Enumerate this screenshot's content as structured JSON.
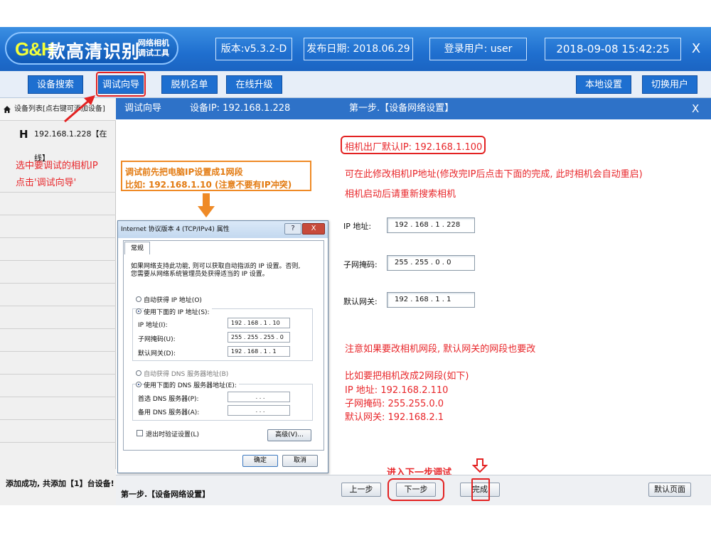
{
  "header": {
    "logo_gh": "G&H",
    "logo_main": "款高清识别",
    "logo_sub_line1": "网络相机",
    "logo_sub_line2": "调试工具",
    "version": "版本:v5.3.2-D",
    "release_date": "发布日期: 2018.06.29",
    "login_user": "登录用户: user",
    "datetime": "2018-09-08 15:42:25",
    "close_label": "X"
  },
  "toolbar": {
    "device_search": "设备搜索",
    "debug_wizard": "调试向导",
    "offline_list": "脱机名单",
    "online_upgrade": "在线升级",
    "local_settings": "本地设置",
    "switch_user": "切换用户"
  },
  "left_panel": {
    "heading": "设备列表[点右键可添加设备]",
    "device_prefix": "H",
    "device_label": "192.168.1.228【在线】",
    "annotation_line1": "选中要调试的相机IP",
    "annotation_line2": "点击'调试向导'",
    "status": "添加成功, 共添加【1】台设备!"
  },
  "panel_header": {
    "title": "调试向导",
    "device_ip": "设备IP: 192.168.1.228",
    "step": "第一步.【设备网络设置】",
    "close": "X"
  },
  "notes": {
    "default_ip": "相机出厂默认IP: 192.168.1.100",
    "modify_line1": "可在此修改相机IP地址(修改完IP后点击下面的完成, 此时相机会自动重启)",
    "modify_line2": "相机启动后请重新搜索相机",
    "segment_note": "注意如果要改相机网段, 默认网关的网段也要改",
    "example_title": "比如要把相机改成2网段(如下)",
    "example_ip": "IP 地址: 192.168.2.110",
    "example_mask": "子网掩码: 255.255.0.0",
    "example_gw": "默认网关: 192.168.2.1",
    "next_step": "进入下一步调试",
    "pc_line1": "调试前先把电脑IP设置成1网段",
    "pc_line2": "比如: 192.168.1.10 (注意不要有IP冲突)"
  },
  "form": {
    "ip_label": "IP 地址:",
    "ip_value": "192 . 168 .  1  . 228",
    "mask_label": "子网掩码:",
    "mask_value": "255 . 255 .  0  .  0",
    "gw_label": "默认网关:",
    "gw_value": "192 . 168 .  1  .  1"
  },
  "footer": {
    "step_label": "第一步.【设备网络设置】",
    "prev": "上一步",
    "next": "下一步",
    "finish": "完成",
    "default_page": "默认页面"
  },
  "dialog": {
    "title": "Internet 协议版本 4 (TCP/IPv4) 属性",
    "help": "?",
    "close": "X",
    "tab": "常规",
    "desc_line1": "如果网络支持此功能, 则可以获取自动指派的 IP 设置。否则,",
    "desc_line2": "您需要从网络系统管理员处获得适当的 IP 设置。",
    "auto_ip": "自动获得 IP 地址(O)",
    "use_ip": "使用下面的 IP 地址(S):",
    "ip_label": "IP 地址(I):",
    "ip_value": "192 . 168 .  1  . 10",
    "mask_label": "子网掩码(U):",
    "mask_value": "255 . 255 . 255 . 0",
    "gw_label": "默认网关(D):",
    "gw_value": "192 . 168 .  1  . 1",
    "auto_dns": "自动获得 DNS 服务器地址(B)",
    "use_dns": "使用下面的 DNS 服务器地址(E):",
    "dns1_label": "首选 DNS 服务器(P):",
    "dns2_label": "备用 DNS 服务器(A):",
    "dns_empty": ".       .       .",
    "validate": "退出时验证设置(L)",
    "advanced": "高级(V)...",
    "ok": "确定",
    "cancel": "取消"
  },
  "colors": {
    "header_blue": "#1f6fcf",
    "annotation_red": "#e8262a",
    "annotation_orange": "#ef8a26",
    "logo_yellow": "#f3ff3a"
  }
}
